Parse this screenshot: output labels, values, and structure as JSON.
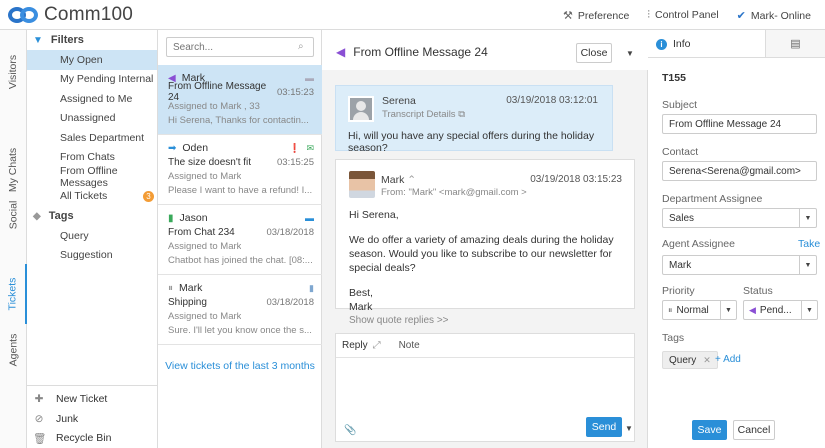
{
  "app": {
    "brand": "Comm100"
  },
  "topbar": {
    "preference": "Preference",
    "control_panel": "Control Panel",
    "status": "Mark- Online"
  },
  "vtabs": [
    "Visitors",
    "My Chats",
    "Social",
    "Tickets",
    "Agents"
  ],
  "filters": {
    "heading": "Filters",
    "items": [
      {
        "label": "My Open",
        "active": true
      },
      {
        "label": "My Pending Internal"
      },
      {
        "label": "Assigned to Me"
      },
      {
        "label": "Unassigned"
      },
      {
        "label": "Sales Department"
      },
      {
        "label": "From Chats"
      },
      {
        "label": "From Offline Messages"
      },
      {
        "label": "All Tickets",
        "badge": "3"
      }
    ],
    "tags_heading": "Tags",
    "tags": [
      "Query",
      "Suggestion"
    ],
    "bottom": [
      "New Ticket",
      "Junk",
      "Recycle Bin"
    ]
  },
  "ticket_list": {
    "search_placeholder": "Search...",
    "tickets": [
      {
        "name": "Mark",
        "subject": "From Offline Message 24",
        "time": "03:15:23",
        "assigned": "Assigned to Mark , 33",
        "preview": "Hi Serena, Thanks for contactin...",
        "status_icon": "arrow-left-icon",
        "status_color": "#8a4fd4",
        "right_icon": "chat-bubble-icon"
      },
      {
        "name": "Oden",
        "subject": "The size doesn't fit",
        "time": "03:15:25",
        "assigned": "Assigned to Mark",
        "preview": "Please I want to have a refund! I...",
        "status_icon": "arrow-right-icon",
        "status_color": "#2a8fd8",
        "right_icon": "email-icon"
      },
      {
        "name": "Jason",
        "subject": "From Chat 234",
        "time": "03/18/2018",
        "assigned": "Assigned to Mark",
        "preview": "Chatbot has joined the chat. [08:...",
        "status_icon": "document-icon",
        "status_color": "#3aa95b",
        "right_icon": "chat-bubble-icon"
      },
      {
        "name": "Mark",
        "subject": "Shipping",
        "time": "03/18/2018",
        "assigned": "Assigned to Mark",
        "preview": "Sure. I'll let you know once the s...",
        "status_icon": "pause-icon",
        "status_color": "#999999",
        "right_icon": "document-icon"
      }
    ],
    "view_more": "View tickets of the last 3 months"
  },
  "conversation": {
    "title": "From Offline Message 24",
    "close_label": "Close",
    "customer_msg": {
      "name": "Serena",
      "sub": "Transcript Details",
      "time": "03/19/2018 03:12:01",
      "body": "Hi, will you have any special offers during the holiday season?"
    },
    "agent_msg": {
      "name": "Mark",
      "from": "From: \"Mark\" <mark@gmail.com >",
      "time": "03/19/2018 03:15:23",
      "greeting": "Hi Serena,",
      "body": "We do offer a variety of amazing deals during the holiday season. Would you like to subscribe to our newsletter for special deals?",
      "closing1": "Best,",
      "closing2": "Mark",
      "show_quote": "Show quote replies >>"
    },
    "reply": {
      "tab_reply": "Reply",
      "tab_note": "Note",
      "send_label": "Send"
    }
  },
  "info": {
    "tab_label": "Info",
    "ticket_id": "T155",
    "subject_label": "Subject",
    "subject_value": "From Offline Message 24",
    "contact_label": "Contact",
    "contact_value": "Serena<Serena@gmail.com>",
    "department_label": "Department Assignee",
    "department_value": "Sales",
    "agent_label": "Agent Assignee",
    "take_label": "Take",
    "agent_value": "Mark",
    "priority_label": "Priority",
    "priority_value": "Normal",
    "status_label": "Status",
    "status_value": "Pend...",
    "tags_label": "Tags",
    "tag_value": "Query",
    "add_tag": "+ Add",
    "save_label": "Save",
    "cancel_label": "Cancel"
  }
}
